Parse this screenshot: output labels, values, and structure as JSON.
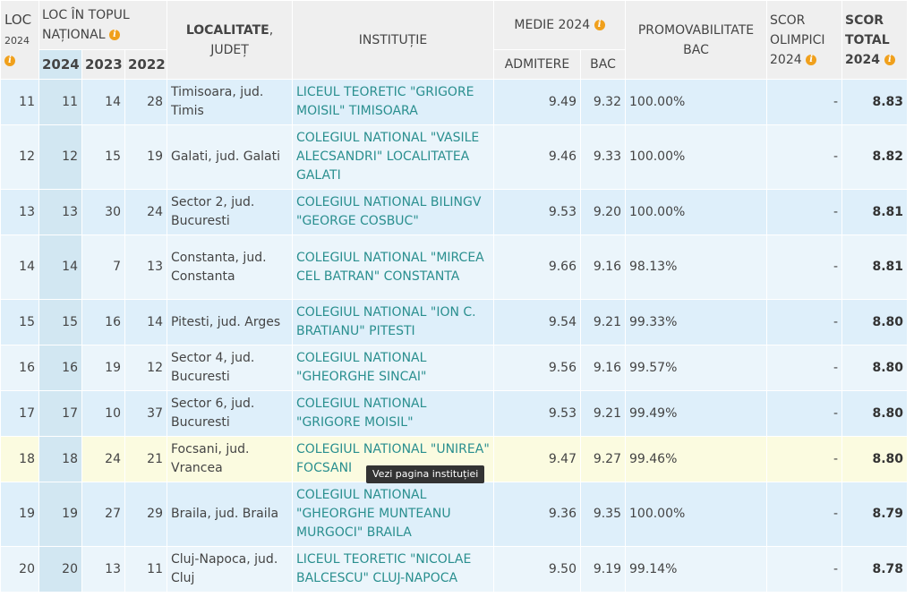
{
  "header": {
    "loc": "LOC",
    "loc_year": "2024",
    "loc_top": "LOC ÎN TOPUL NAȚIONAL",
    "years": [
      "2024",
      "2023",
      "2022"
    ],
    "localitate": "LOCALITATE",
    "judet": ", JUDEȚ",
    "institutie": "INSTITUȚIE",
    "medie": "MEDIE 2024",
    "admitere": "ADMITERE",
    "bac": "BAC",
    "promovabilitate": "PROMOVABILITATE BAC",
    "scor_olimpici": "SCOR OLIMPICI 2024",
    "scor_total": "SCOR TOTAL 2024"
  },
  "tooltip": "Vezi pagina instituției",
  "rows": [
    {
      "loc": "11",
      "y2024": "11",
      "y2023": "14",
      "y2022": "28",
      "city": "Timisoara",
      "county": ", jud. Timis",
      "inst": "LICEUL TEORETIC \"GRIGORE MOISIL\" TIMISOARA",
      "adm": "9.49",
      "bac": "9.32",
      "promo": "100.00%",
      "olimp": "-",
      "total": "8.83"
    },
    {
      "loc": "12",
      "y2024": "12",
      "y2023": "15",
      "y2022": "19",
      "city": "Galati",
      "county": ", jud. Galati",
      "inst": "COLEGIUL NATIONAL \"VASILE ALECSANDRI\" LOCALITATEA GALATI",
      "adm": "9.46",
      "bac": "9.33",
      "promo": "100.00%",
      "olimp": "-",
      "total": "8.82"
    },
    {
      "loc": "13",
      "y2024": "13",
      "y2023": "30",
      "y2022": "24",
      "city": "Sector 2",
      "county": ", jud. Bucuresti",
      "inst": "COLEGIUL NATIONAL BILINGV \"GEORGE COSBUC\"",
      "adm": "9.53",
      "bac": "9.20",
      "promo": "100.00%",
      "olimp": "-",
      "total": "8.81"
    },
    {
      "loc": "14",
      "y2024": "14",
      "y2023": "7",
      "y2022": "13",
      "city": "Constanta",
      "county": ", jud. Constanta",
      "inst": "COLEGIUL NATIONAL \"MIRCEA CEL BATRAN\" CONSTANTA",
      "adm": "9.66",
      "bac": "9.16",
      "promo": "98.13%",
      "olimp": "-",
      "total": "8.81"
    },
    {
      "loc": "15",
      "y2024": "15",
      "y2023": "16",
      "y2022": "14",
      "city": "Pitesti",
      "county": ", jud. Arges",
      "inst": "COLEGIUL NATIONAL \"ION C. BRATIANU\" PITESTI",
      "adm": "9.54",
      "bac": "9.21",
      "promo": "99.33%",
      "olimp": "-",
      "total": "8.80"
    },
    {
      "loc": "16",
      "y2024": "16",
      "y2023": "19",
      "y2022": "12",
      "city": "Sector 4",
      "county": ", jud. Bucuresti",
      "inst": "COLEGIUL NATIONAL \"GHEORGHE SINCAI\"",
      "adm": "9.56",
      "bac": "9.16",
      "promo": "99.57%",
      "olimp": "-",
      "total": "8.80"
    },
    {
      "loc": "17",
      "y2024": "17",
      "y2023": "10",
      "y2022": "37",
      "city": "Sector 6",
      "county": ", jud. Bucuresti",
      "inst": "COLEGIUL NATIONAL \"GRIGORE MOISIL\"",
      "adm": "9.53",
      "bac": "9.21",
      "promo": "99.49%",
      "olimp": "-",
      "total": "8.80"
    },
    {
      "loc": "18",
      "y2024": "18",
      "y2023": "24",
      "y2022": "21",
      "city": "Focsani",
      "county": ", jud. Vrancea",
      "inst": "COLEGIUL NATIONAL \"UNIREA\" FOCSANI",
      "adm": "9.47",
      "bac": "9.27",
      "promo": "99.46%",
      "olimp": "-",
      "total": "8.80"
    },
    {
      "loc": "19",
      "y2024": "19",
      "y2023": "27",
      "y2022": "29",
      "city": "Braila",
      "county": ", jud. Braila",
      "inst": "COLEGIUL NATIONAL \"GHEORGHE MUNTEANU MURGOCI\" BRAILA",
      "adm": "9.36",
      "bac": "9.35",
      "promo": "100.00%",
      "olimp": "-",
      "total": "8.79"
    },
    {
      "loc": "20",
      "y2024": "20",
      "y2023": "13",
      "y2022": "11",
      "city": "Cluj-Napoca",
      "county": ", jud. Cluj",
      "inst": "LICEUL TEORETIC \"NICOLAE BALCESCU\" CLUJ-NAPOCA",
      "adm": "9.50",
      "bac": "9.19",
      "promo": "99.14%",
      "olimp": "-",
      "total": "8.78"
    }
  ]
}
